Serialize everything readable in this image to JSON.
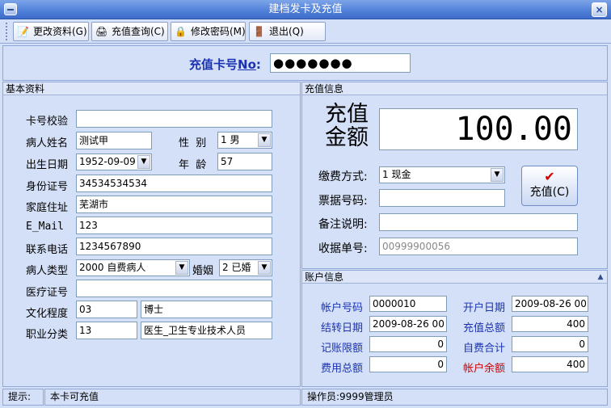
{
  "window": {
    "title": "建档发卡及充值",
    "close_glyph": "×"
  },
  "toolbar": {
    "edit": {
      "label": "更改资料(G)",
      "icon": "edit-document-icon"
    },
    "query": {
      "label": "充值查询(C)",
      "icon": "query-icon"
    },
    "password": {
      "label": "修改密码(M)",
      "icon": "lock-icon"
    },
    "exit": {
      "label": "退出(Q)",
      "icon": "exit-door-icon"
    }
  },
  "card": {
    "label_prefix": "充值卡号",
    "label_no": "No",
    "label_suffix": ":",
    "value": "●●●●●●●"
  },
  "basic": {
    "header": "基本资料",
    "card_verify": {
      "label": "卡号校验",
      "value": ""
    },
    "patient_name": {
      "label": "病人姓名",
      "value": "测试甲"
    },
    "gender": {
      "label": "性  别",
      "value": "1 男"
    },
    "birth_date": {
      "label": "出生日期",
      "value": "1952-09-09"
    },
    "age": {
      "label": "年  龄",
      "value": "57"
    },
    "id_number": {
      "label": "身份证号",
      "value": "34534534534"
    },
    "address": {
      "label": "家庭住址",
      "value": "芜湖市"
    },
    "email": {
      "label": "E_Mail",
      "value": "123"
    },
    "phone": {
      "label": "联系电话",
      "value": "1234567890"
    },
    "patient_type": {
      "label": "病人类型",
      "value": "2000 自费病人"
    },
    "marriage": {
      "label": "婚姻",
      "value": "2 已婚"
    },
    "medical_card": {
      "label": "医疗证号",
      "value": ""
    },
    "education": {
      "label": "文化程度",
      "code": "03",
      "value": "博士"
    },
    "occupation": {
      "label": "职业分类",
      "code": "13",
      "value": "医生_卫生专业技术人员"
    }
  },
  "recharge": {
    "header": "充值信息",
    "amount_label_1": "充值",
    "amount_label_2": "金额",
    "amount": "100.00",
    "payment_method": {
      "label": "缴费方式:",
      "value": "1 现金"
    },
    "receipt_no": {
      "label": "票据号码:",
      "value": ""
    },
    "remark": {
      "label": "备注说明:",
      "value": ""
    },
    "receipt_serial": {
      "label": "收据单号:",
      "value": "00999900056"
    },
    "charge_button": "充值(C)"
  },
  "account": {
    "header": "账户信息",
    "collapse_glyph": "▲",
    "account_no": {
      "label": "帐户号码",
      "value": "0000010"
    },
    "open_date": {
      "label": "开户日期",
      "value": "2009-08-26 00"
    },
    "settle_date": {
      "label": "结转日期",
      "value": "2009-08-26 00"
    },
    "recharge_total": {
      "label": "充值总额",
      "value": "400"
    },
    "credit_limit": {
      "label": "记账限额",
      "value": "0"
    },
    "self_pay_total": {
      "label": "自费合计",
      "value": "0"
    },
    "expense_total": {
      "label": "费用总额",
      "value": "0"
    },
    "balance": {
      "label": "帐户余额",
      "value": "400"
    }
  },
  "statusbar": {
    "hint_label": "提示:",
    "hint": "本卡可充值",
    "operator": "操作员:9999管理员"
  },
  "colors": {
    "label_blue": "#1b33b3",
    "balance_red": "#d00000",
    "title_blue": "#4f7fd8"
  }
}
